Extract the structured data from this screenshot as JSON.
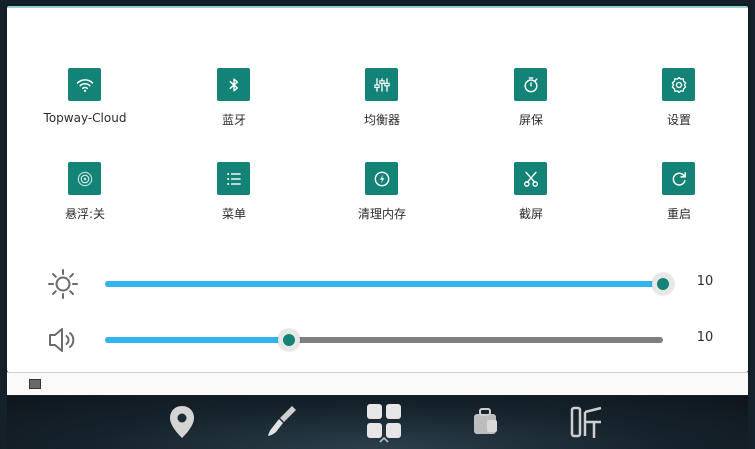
{
  "quick_tiles": [
    {
      "label": "Topway-Cloud",
      "icon": "wifi-icon"
    },
    {
      "label": "蓝牙",
      "icon": "bluetooth-icon"
    },
    {
      "label": "均衡器",
      "icon": "equalizer-icon"
    },
    {
      "label": "屏保",
      "icon": "timer-icon"
    },
    {
      "label": "设置",
      "icon": "gear-icon"
    },
    {
      "label": "悬浮:关",
      "icon": "floating-ball-icon"
    },
    {
      "label": "菜单",
      "icon": "menu-list-icon"
    },
    {
      "label": "清理内存",
      "icon": "clean-memory-icon"
    },
    {
      "label": "截屏",
      "icon": "scissors-icon"
    },
    {
      "label": "重启",
      "icon": "restart-icon"
    }
  ],
  "sliders": {
    "brightness": {
      "value": "10",
      "level": 1.0,
      "icon": "brightness-icon"
    },
    "volume": {
      "value": "10",
      "level": 0.33,
      "icon": "speaker-icon"
    }
  },
  "colors": {
    "tile_accent": "#128376",
    "slider_fill": "#32b5ec",
    "slider_track": "#7f7f7f"
  },
  "dock": {
    "icons": [
      "location-pin-icon",
      "paint-brush-icon",
      "apps-grid-icon",
      "toolbox-icon",
      "radio-icon"
    ]
  }
}
